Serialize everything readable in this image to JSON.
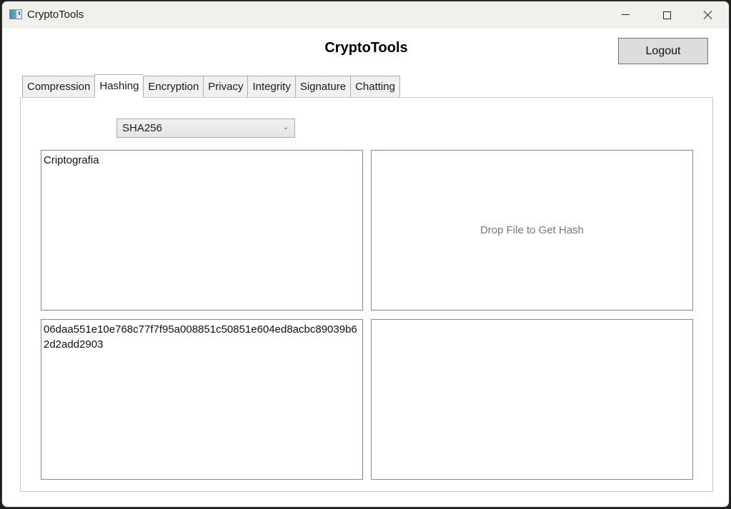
{
  "window": {
    "title": "CryptoTools",
    "controls": {
      "minimize": "minimize",
      "maximize": "maximize",
      "close": "close"
    }
  },
  "header": {
    "app_title": "CryptoTools",
    "logout_label": "Logout"
  },
  "tabs": [
    {
      "label": "Compression",
      "active": false
    },
    {
      "label": "Hashing",
      "active": true
    },
    {
      "label": "Encryption",
      "active": false
    },
    {
      "label": "Privacy",
      "active": false
    },
    {
      "label": "Integrity",
      "active": false
    },
    {
      "label": "Signature",
      "active": false
    },
    {
      "label": "Chatting",
      "active": false
    }
  ],
  "hashing": {
    "algorithm": {
      "selected": "SHA256",
      "icon": "chevron-down-icon"
    },
    "input_text": "Criptografia",
    "drop_zone_label": "Drop File to Get Hash",
    "text_hash": "06daa551e10e768c77f7f95a008851c50851e604ed8acbc89039b62d2add2903",
    "file_hash": ""
  }
}
